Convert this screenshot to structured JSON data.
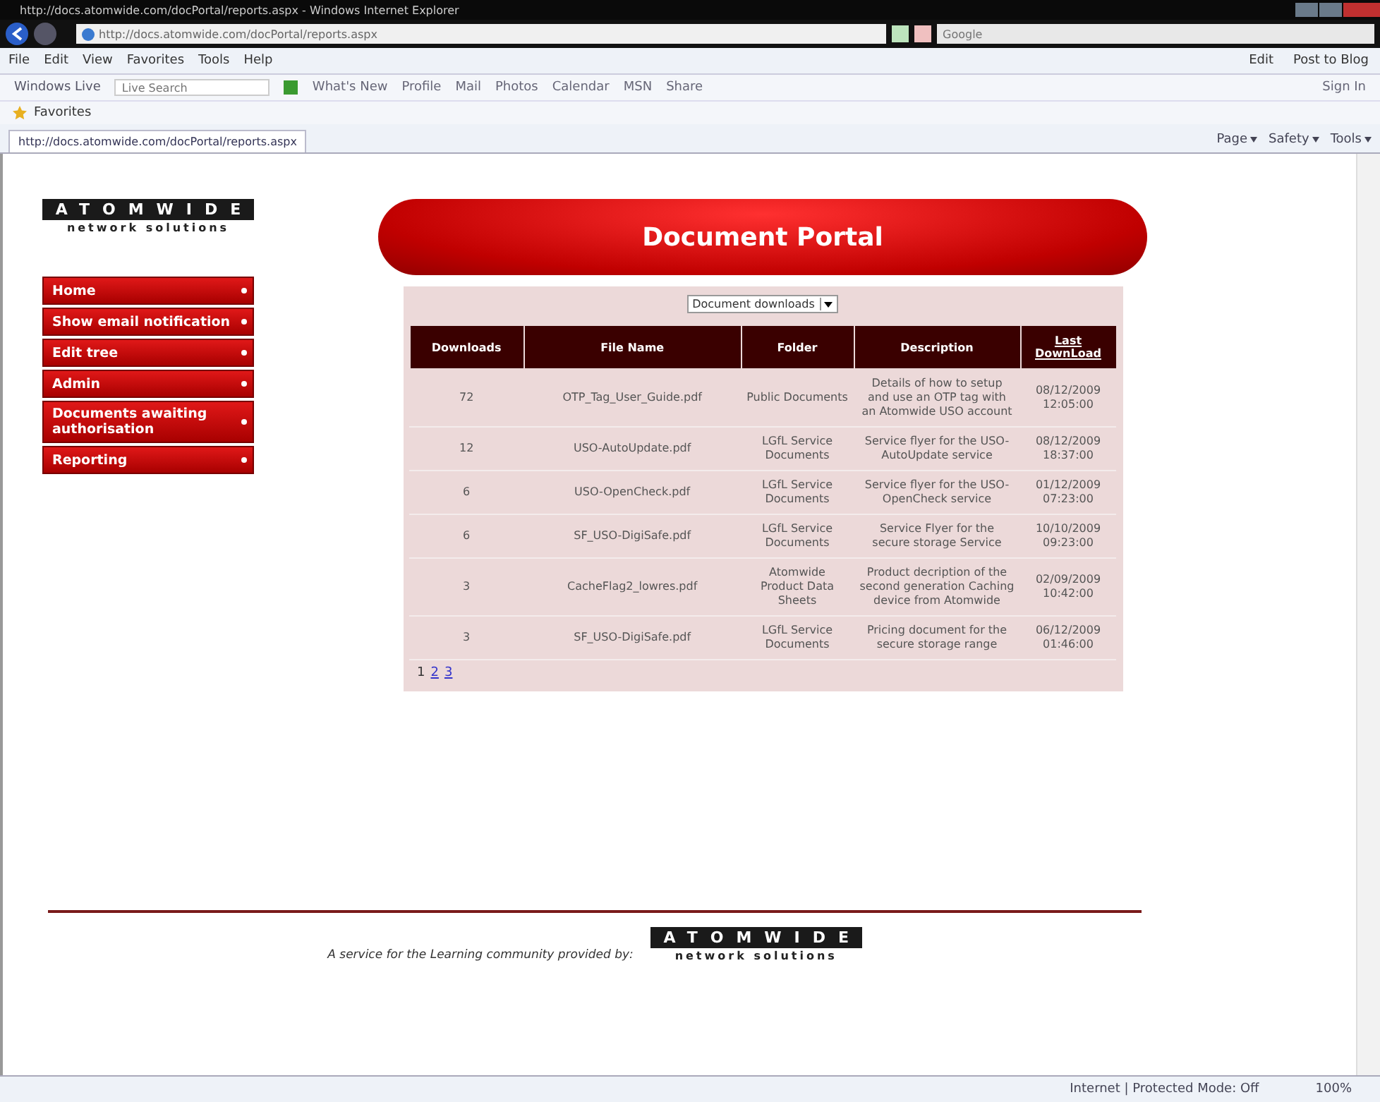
{
  "browser": {
    "title": "http://docs.atomwide.com/docPortal/reports.aspx - Windows Internet Explorer",
    "address": "http://docs.atomwide.com/docPortal/reports.aspx",
    "search_placeholder": "Google",
    "menu": [
      "File",
      "Edit",
      "View",
      "Favorites",
      "Tools",
      "Help"
    ],
    "blog_buttons": [
      "Edit",
      "Post to Blog"
    ],
    "live_label": "Windows Live",
    "live_search_placeholder": "Live Search",
    "live_links": [
      "What's New",
      "Profile",
      "Mail",
      "Photos",
      "Calendar",
      "MSN",
      "Share"
    ],
    "sign_in": "Sign In",
    "favorites": "Favorites",
    "tab_title": "http://docs.atomwide.com/docPortal/reports.aspx",
    "commands": [
      "Page",
      "Safety",
      "Tools"
    ],
    "status_text": "Internet | Protected Mode: Off",
    "zoom": "100%"
  },
  "logo": {
    "word": "ATOMWIDE",
    "tagline": "network solutions"
  },
  "nav": [
    {
      "label": "Home"
    },
    {
      "label": "Show email notification"
    },
    {
      "label": "Edit tree"
    },
    {
      "label": "Admin"
    },
    {
      "label": "Documents awaiting authorisation"
    },
    {
      "label": "Reporting"
    }
  ],
  "banner": "Document Portal",
  "report_select": "Document downloads",
  "table": {
    "columns": [
      {
        "label": "Downloads",
        "link": false
      },
      {
        "label": "File Name",
        "link": false
      },
      {
        "label": "Folder",
        "link": false
      },
      {
        "label": "Description",
        "link": false
      },
      {
        "label": "Last DownLoad",
        "link": true
      }
    ],
    "rows": [
      [
        "72",
        "OTP_Tag_User_Guide.pdf",
        "Public Documents",
        "Details of how to setup and use an OTP tag with an Atomwide USO account",
        "08/12/2009 12:05:00"
      ],
      [
        "12",
        "USO-AutoUpdate.pdf",
        "LGfL Service Documents",
        "Service flyer for the USO-AutoUpdate service",
        "08/12/2009 18:37:00"
      ],
      [
        "6",
        "USO-OpenCheck.pdf",
        "LGfL Service Documents",
        "Service flyer for the USO-OpenCheck service",
        "01/12/2009 07:23:00"
      ],
      [
        "6",
        "SF_USO-DigiSafe.pdf",
        "LGfL Service Documents",
        "Service Flyer for the secure storage Service",
        "10/10/2009 09:23:00"
      ],
      [
        "3",
        "CacheFlag2_lowres.pdf",
        "Atomwide Product Data Sheets",
        "Product decription of the second generation Caching device from Atomwide",
        "02/09/2009 10:42:00"
      ],
      [
        "3",
        "SF_USO-DigiSafe.pdf",
        "LGfL Service Documents",
        "Pricing document for the secure storage range",
        "06/12/2009 01:46:00"
      ]
    ]
  },
  "pager": [
    {
      "label": "1",
      "selected": true
    },
    {
      "label": "2",
      "selected": false
    },
    {
      "label": "3",
      "selected": false
    }
  ],
  "footer": {
    "text": "A service for the Learning community provided by:",
    "logo_word": "ATOMWIDE",
    "logo_tagline": "network solutions"
  }
}
